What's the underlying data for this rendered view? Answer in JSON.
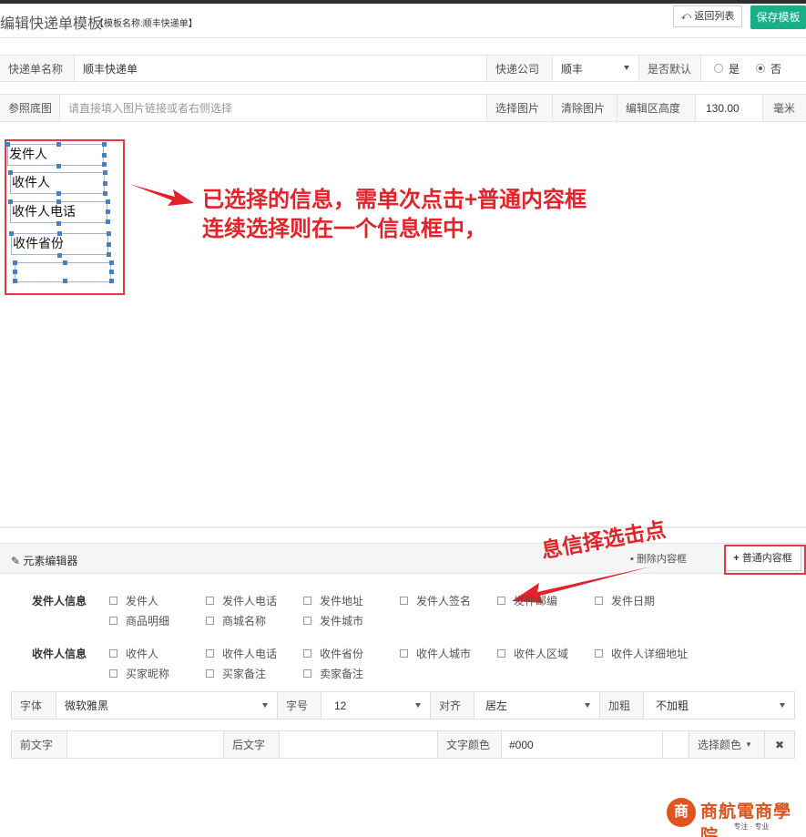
{
  "header": {
    "title": "编辑快递单模板",
    "subtitle": "【模板名称:顺丰快递单】",
    "back_label": "返回列表",
    "save_label": "保存模板"
  },
  "form": {
    "name_label": "快递单名称",
    "name_value": "顺丰快递单",
    "company_label": "快递公司",
    "company_value": "顺丰",
    "default_label": "是否默认",
    "yes_label": "是",
    "no_label": "否",
    "default_selected": "否",
    "bg_label": "参照底图",
    "bg_placeholder": "请直接填入图片链接或者右侧选择",
    "choose_image": "选择图片",
    "clear_image": "清除图片",
    "height_label": "编辑区高度",
    "height_value": "130.00",
    "unit": "毫米"
  },
  "canvas": {
    "fields": [
      "发件人",
      "收件人",
      "收件人电话",
      "收件省份",
      ""
    ]
  },
  "annotations": {
    "main_line1": "已选择的信息，需单次点击+普通内容框",
    "main_line2": "连续选择则在一个信息框中，",
    "click_hint": "息信择选击点"
  },
  "editor": {
    "title": "元素编辑器",
    "delete_label": "删除内容框",
    "add_label": "普通内容框",
    "sender_group": "发件人信息",
    "sender_items": [
      "发件人",
      "发件人电话",
      "发件地址",
      "发件人签名",
      "发件邮编",
      "发件日期",
      "商品明细",
      "商城名称",
      "发件城市"
    ],
    "receiver_group": "收件人信息",
    "receiver_items": [
      "收件人",
      "收件人电话",
      "收件省份",
      "收件人城市",
      "收件人区域",
      "收件人详细地址",
      "买家昵称",
      "买家备注",
      "卖家备注"
    ],
    "font_label": "字体",
    "font_value": "微软雅黑",
    "size_label": "字号",
    "size_value": "12",
    "align_label": "对齐",
    "align_value": "居左",
    "bold_label": "加粗",
    "bold_value": "不加粗",
    "prefix_label": "前文字",
    "suffix_label": "后文字",
    "color_label": "文字颜色",
    "color_value": "#000",
    "pick_color": "选择颜色"
  },
  "logo": {
    "mark": "商",
    "name": "商航電商學院",
    "tagline": "专注 · 专业"
  },
  "colors": {
    "accent": "#1aae88",
    "highlight": "#e5393f",
    "annotation": "#e3222a"
  }
}
